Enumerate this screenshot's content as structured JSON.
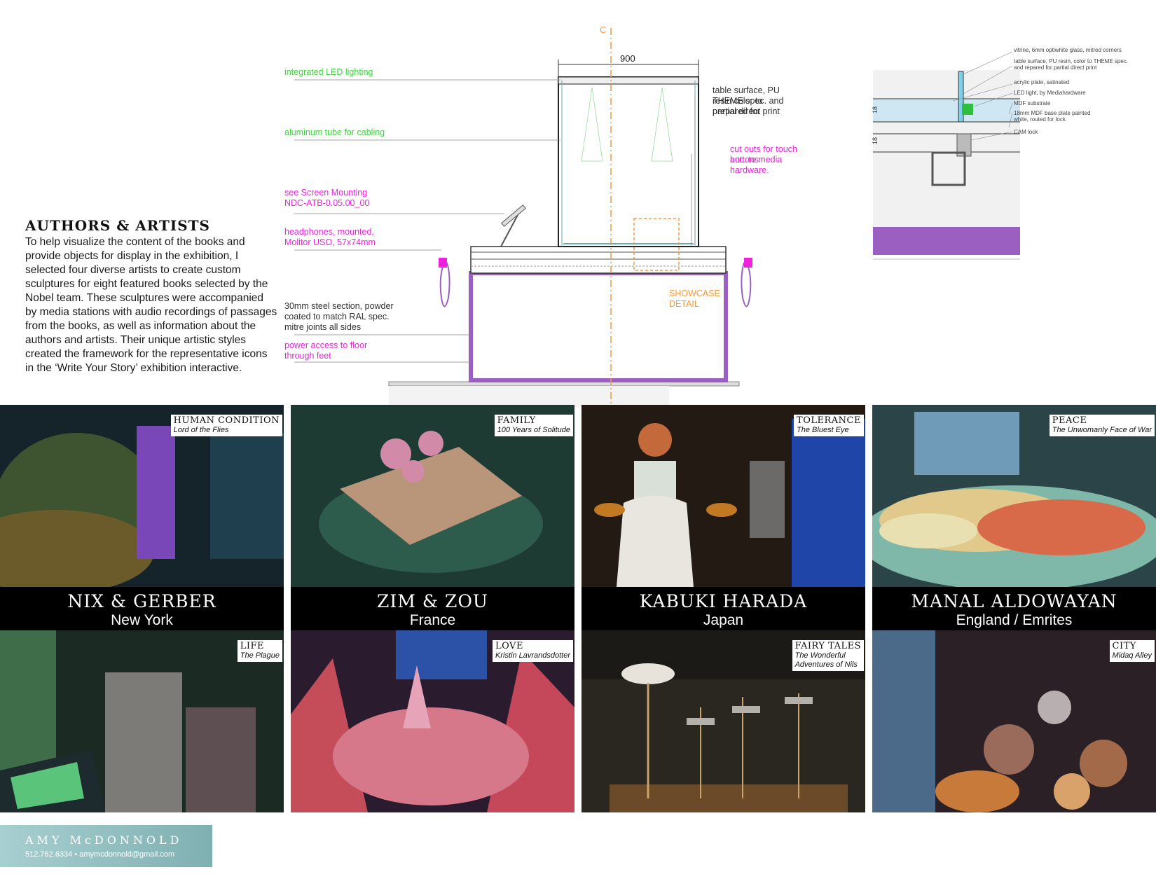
{
  "intro": {
    "title": "AUTHORS & ARTISTS",
    "body": "To help visualize the content of the books and provide objects for display in the exhibition, I selected four diverse artists to create custom sculptures for eight featured books selected by the Nobel team. These sculptures were accompanied by media stations with audio recordings of passages from the books, as well as information about the authors and artists. Their unique artistic styles created the framework for the representative icons in the ‘Write Your Story’ exhibition interactive."
  },
  "drawing": {
    "dimension": "900",
    "centerline": "C",
    "labels": {
      "led": "integrated LED lighting",
      "aluminum": "aluminum tube for cabling",
      "screen_1": "see Screen Mounting",
      "screen_2": "NDC-ATB-0.05.00_00",
      "headphones_1": "headphones, mounted,",
      "headphones_2": "Molitor USO, 57x74mm",
      "steel_1": "30mm steel section, powder",
      "steel_2": "coated to match RAL spec.",
      "steel_3": "mitre joints all sides",
      "power_1": "power access to floor",
      "power_2": "through feet",
      "table_1": "table surface, PU resin color to",
      "table_2": "THEME spec. and prepared for",
      "table_3": "partial direct print",
      "cutouts_1": "cut outs for touch buttons",
      "cutouts_2": "acc. to media hardware.",
      "showcase_1": "SHOWCASE",
      "showcase_2": "DETAIL"
    }
  },
  "detail": {
    "dims": [
      "18",
      "18"
    ],
    "notes": [
      "vitrine, 6mm optiwhite glass, mitred corners",
      "table surface, PU resin, color to THEME spec.",
      "and repared for partial direct print",
      "acrylic plate, satinated",
      "LED light, by Mediahardware",
      "MDF substrate",
      "18mm MDF base plate painted",
      "white, routed for lock",
      "CAM lock"
    ]
  },
  "artists": [
    {
      "name": "NIX & GERBER",
      "location": "New York",
      "top": {
        "theme": "HUMAN CONDITION",
        "book": "Lord of the Flies"
      },
      "bottom": {
        "theme": "LIFE",
        "book": "The Plague"
      }
    },
    {
      "name": "ZIM & ZOU",
      "location": "France",
      "top": {
        "theme": "FAMILY",
        "book": "100 Years of Solitude"
      },
      "bottom": {
        "theme": "LOVE",
        "book": "Kristin Lavrandsdotter"
      }
    },
    {
      "name": "KABUKI HARADA",
      "location": "Japan",
      "top": {
        "theme": "TOLERANCE",
        "book": "The Bluest Eye"
      },
      "bottom": {
        "theme": "FAIRY TALES",
        "book": "The Wonderful",
        "book2": "Adventures of Nils"
      }
    },
    {
      "name": "MANAL ALDOWAYAN",
      "location": "England / Emrites",
      "top": {
        "theme": "PEACE",
        "book": "The Unwomanly Face of War"
      },
      "bottom": {
        "theme": "CITY",
        "book": "Midaq Alley"
      }
    }
  ],
  "footer": {
    "name": "AMY McDONNOLD",
    "contact": "512.762.6334 • amymcdonnold@gmail.com"
  },
  "colors": {
    "accent_green": "#3fd23f",
    "accent_pink": "#ee22dd",
    "accent_orange": "#f39a3a",
    "frame_purple": "#9a5fc0",
    "footer_teal": "#8fbfc0"
  }
}
